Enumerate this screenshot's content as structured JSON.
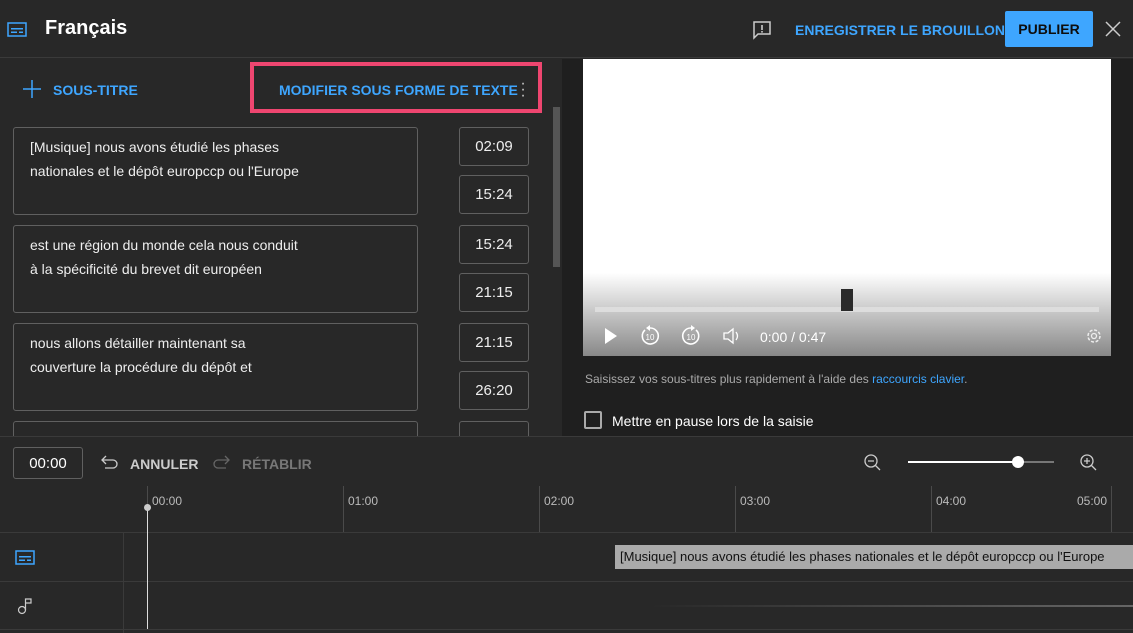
{
  "header": {
    "title": "Français",
    "save_draft": "ENREGISTRER LE BROUILLON",
    "publish": "PUBLIER"
  },
  "toolbar": {
    "add_subtitle": "SOUS-TITRE",
    "edit_as_text": "MODIFIER SOUS FORME DE TEXTE"
  },
  "cues": [
    {
      "text1": "[Musique] nous avons étudié les phases",
      "text2": "nationales et le dépôt europcсp ou l'Europe",
      "start": "02:09",
      "end": "15:24"
    },
    {
      "text1": "est une région du monde cela nous conduit",
      "text2": "à la spécificité du brevet dit européen",
      "start": "15:24",
      "end": "21:15"
    },
    {
      "text1": "nous allons détailler maintenant sa",
      "text2": "couverture la procédure du dépôt et",
      "start": "21:15",
      "end": "26:20"
    }
  ],
  "player": {
    "time": "0:00 / 0:47",
    "progress": 0.5
  },
  "hint": {
    "text": "Saisissez vos sous-titres plus rapidement à l'aide des ",
    "link": "raccourcis clavier",
    "end": "."
  },
  "pause_checkbox": {
    "label": "Mettre en pause lors de la saisie",
    "checked": false
  },
  "timeline": {
    "current": "00:00",
    "undo": "ANNULER",
    "redo": "RÉTABLIR",
    "zoom_level": 0.75,
    "ticks": [
      "00:00",
      "01:00",
      "02:00",
      "03:00",
      "04:00",
      "05:00"
    ],
    "subtitle_block": "[Musique] nous avons étudié les phases  nationales et le dépôt europcсp ou l'Europe"
  }
}
